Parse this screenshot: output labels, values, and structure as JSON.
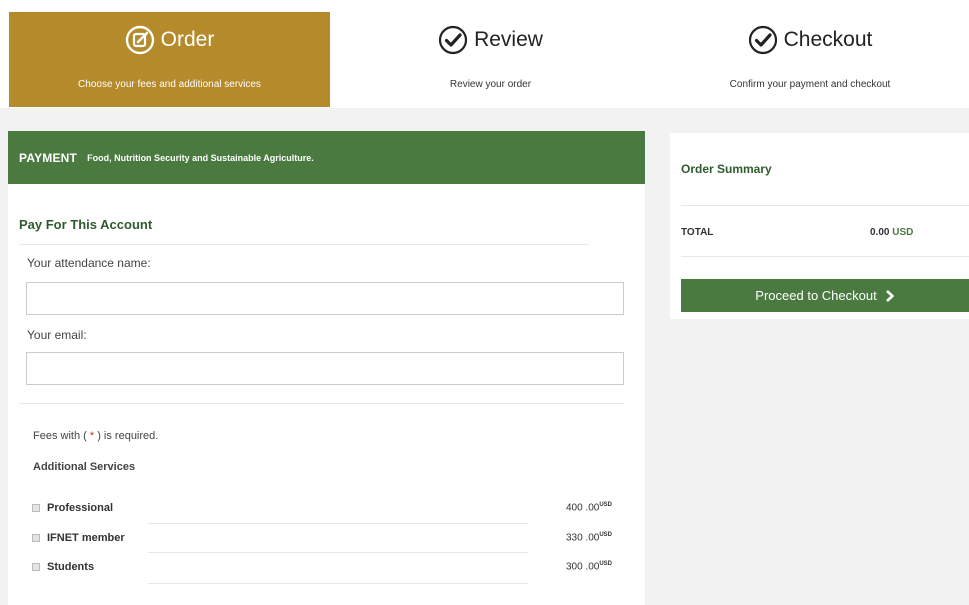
{
  "steps": [
    {
      "title": "Order",
      "desc": "Choose your fees and additional services",
      "icon": "edit-circle-icon",
      "active": true
    },
    {
      "title": "Review",
      "desc": "Review your order",
      "icon": "check-circle-icon",
      "active": false
    },
    {
      "title": "Checkout",
      "desc": "Confirm your payment and checkout",
      "icon": "check-circle-icon",
      "active": false
    }
  ],
  "payment": {
    "label": "PAYMENT",
    "subtitle": "Food, Nutrition Security and Sustainable Agriculture."
  },
  "form": {
    "section_title": "Pay For This Account",
    "name_label": "Your attendance name:",
    "name_value": "",
    "email_label": "Your email:",
    "email_value": ""
  },
  "fees": {
    "note_prefix": "Fees with ( ",
    "note_star": "*",
    "note_suffix": " ) is required.",
    "additional_title": "Additional Services",
    "services": [
      {
        "name": "Professional",
        "price": "400 .00",
        "currency": "USD"
      },
      {
        "name": "IFNET member",
        "price": "330 .00",
        "currency": "USD"
      },
      {
        "name": "Students",
        "price": "300 .00",
        "currency": "USD"
      }
    ]
  },
  "summary": {
    "title": "Order Summary",
    "total_label": "TOTAL",
    "total_amount": "0.00",
    "total_currency": "USD",
    "checkout_label": "Proceed to Checkout"
  },
  "colors": {
    "accent_gold": "#b58a2b",
    "accent_green": "#4a7a3f",
    "title_green": "#2f5c2d",
    "required_red": "#d62b2b"
  }
}
